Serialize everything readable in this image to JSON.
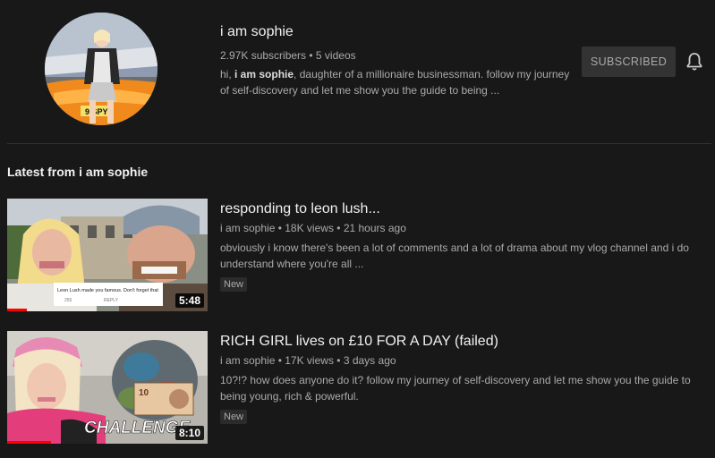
{
  "channel": {
    "name": "i am sophie",
    "subscribers": "2.97K subscribers",
    "videos": "5 videos",
    "meta_separator": " • ",
    "description_prefix": "hi, ",
    "description_bold": "i am sophie",
    "description_rest": ", daughter of a millionaire businessman. follow my journey of self-discovery and let me show you the guide to being ...",
    "subscribe_label": "SUBSCRIBED",
    "bell_icon": "bell-icon",
    "avatar_plate_text": "9 SPY"
  },
  "section": {
    "title": "Latest from i am sophie"
  },
  "videos": [
    {
      "title": "responding to leon lush...",
      "channel": "i am sophie",
      "views": "18K views",
      "age": "21 hours ago",
      "description": "obviously i know there's been a lot of comments and a lot of drama about my vlog channel and i do understand where you're all ...",
      "badge": "New",
      "duration": "5:48",
      "watch_progress": 0.1,
      "thumb_caption": "Leon Lush made you famous. Don't forget that",
      "thumb_reply": "REPLY",
      "thumb_likes": "255"
    },
    {
      "title": "RICH GIRL lives on £10 FOR A DAY (failed)",
      "channel": "i am sophie",
      "views": "17K views",
      "age": "3 days ago",
      "description": "10?!? how does anyone do it? follow my journey of self-discovery and let me show you the guide to being young, rich & powerful.",
      "badge": "New",
      "duration": "8:10",
      "watch_progress": 0.22,
      "thumb_text": "CHALLENGE",
      "thumb_banknote": "10"
    }
  ],
  "colors": {
    "background": "#181818",
    "button_bg": "#333333",
    "progress": "#ff0000",
    "text_primary": "#f1f1f1",
    "text_secondary": "#aaaaaa"
  }
}
